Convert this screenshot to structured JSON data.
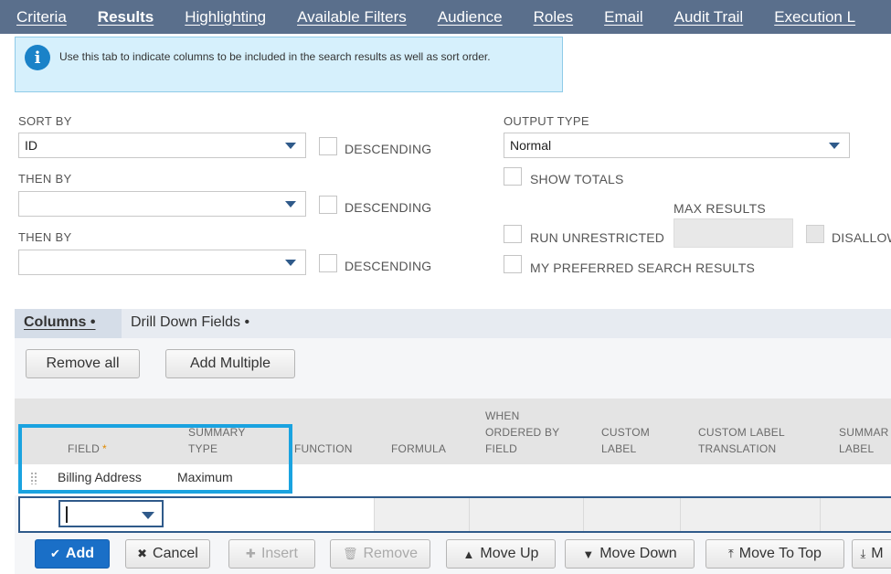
{
  "tabs": [
    {
      "label": "Criteria",
      "active": false
    },
    {
      "label": "Results",
      "active": true
    },
    {
      "label": "Highlighting",
      "active": false
    },
    {
      "label": "Available Filters",
      "active": false
    },
    {
      "label": "Audience",
      "active": false
    },
    {
      "label": "Roles",
      "active": false
    },
    {
      "label": "Email",
      "active": false
    },
    {
      "label": "Audit Trail",
      "active": false
    },
    {
      "label": "Execution L",
      "active": false
    }
  ],
  "info": {
    "icon": "info-icon",
    "text": "Use this tab to indicate columns to be included in the search results as well as sort order."
  },
  "sort": {
    "sort_by_label": "SORT BY",
    "sort_by_value": "ID",
    "then_by_1_label": "THEN BY",
    "then_by_1_value": "",
    "then_by_2_label": "THEN BY",
    "then_by_2_value": "",
    "descending_label": "DESCENDING"
  },
  "output": {
    "output_type_label": "OUTPUT TYPE",
    "output_type_value": "Normal",
    "show_totals_label": "SHOW TOTALS",
    "max_results_label": "MAX RESULTS",
    "max_results_value": "",
    "run_unrestricted_label": "RUN UNRESTRICTED",
    "disallow_label": "DISALLOW",
    "my_preferred_label": "MY PREFERRED SEARCH RESULTS"
  },
  "subtabs": [
    {
      "label": "Columns •",
      "active": true
    },
    {
      "label": "Drill Down Fields •",
      "active": false
    }
  ],
  "column_buttons": {
    "remove_all": "Remove all",
    "add_multiple": "Add Multiple"
  },
  "table": {
    "headers": {
      "field": "FIELD",
      "required_mark": "*",
      "summary_type_1": "SUMMARY",
      "summary_type_2": "TYPE",
      "function": "FUNCTION",
      "formula": "FORMULA",
      "when_1": "WHEN",
      "when_2": "ORDERED BY",
      "when_3": "FIELD",
      "custom_label_1": "CUSTOM",
      "custom_label_2": "LABEL",
      "clt_1": "CUSTOM LABEL",
      "clt_2": "TRANSLATION",
      "summary_label_1": "SUMMAR",
      "summary_label_2": "LABEL"
    },
    "rows": [
      {
        "field": "Billing Address",
        "summary_type": "Maximum"
      }
    ]
  },
  "actions": {
    "add": "Add",
    "cancel": "Cancel",
    "insert": "Insert",
    "remove": "Remove",
    "move_up": "Move Up",
    "move_down": "Move Down",
    "move_to_top": "Move To Top",
    "move_to_bottom": "M"
  },
  "colors": {
    "tabbar": "#5a6f8c",
    "primary": "#1a6fc7",
    "highlight": "#1aa3e0",
    "info_bg": "#d6f0fc"
  }
}
